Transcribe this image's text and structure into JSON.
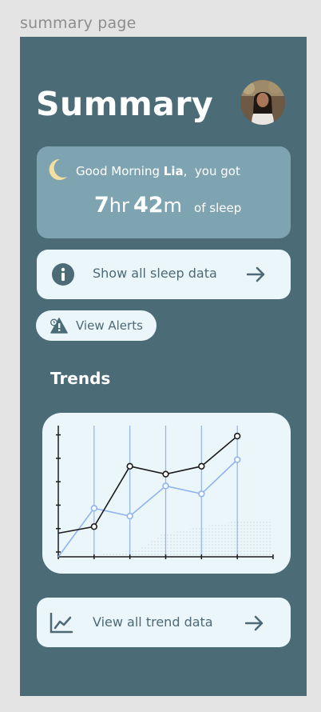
{
  "frame_label": "summary page",
  "header": {
    "title": "Summary"
  },
  "greeting": {
    "prefix": "Good Morning",
    "name": "Lia",
    "suffix": ",  you got",
    "hours": "7",
    "hours_unit": "hr",
    "minutes": "42",
    "minutes_unit": "m",
    "of_sleep": "of sleep"
  },
  "actions": {
    "sleep_data_label": "Show all sleep data",
    "alerts_label": "View Alerts",
    "trend_data_label": "View all trend data"
  },
  "trends": {
    "title": "Trends"
  },
  "icons": {
    "moon": "moon-icon",
    "info": "info-icon",
    "alert": "alert-icon",
    "arrow": "arrow-right-icon",
    "trend": "trend-chart-icon"
  },
  "colors": {
    "screen_bg": "#4b6b77",
    "greeting_card": "#7fa4b1",
    "button_bg": "#ebf6fb",
    "button_text": "#4d6975",
    "moon": "#f3dfa2",
    "series_dark": "#1c1c1c",
    "series_light": "#8eb3ee"
  },
  "chart_data": {
    "type": "line",
    "title": "",
    "xlabel": "",
    "ylabel": "",
    "x": [
      0,
      1,
      2,
      3,
      4,
      5,
      6
    ],
    "ylim": [
      0,
      10
    ],
    "series": [
      {
        "values": [
          1.8,
          2.3,
          6.9,
          6.3,
          6.9,
          9.2
        ],
        "x": [
          0,
          1,
          2,
          3,
          4,
          5
        ]
      },
      {
        "values": [
          0,
          3.7,
          3.1,
          5.4,
          4.8,
          7.4
        ],
        "x": [
          0,
          1,
          2,
          3,
          4,
          5
        ]
      }
    ],
    "grid": "vertical"
  }
}
